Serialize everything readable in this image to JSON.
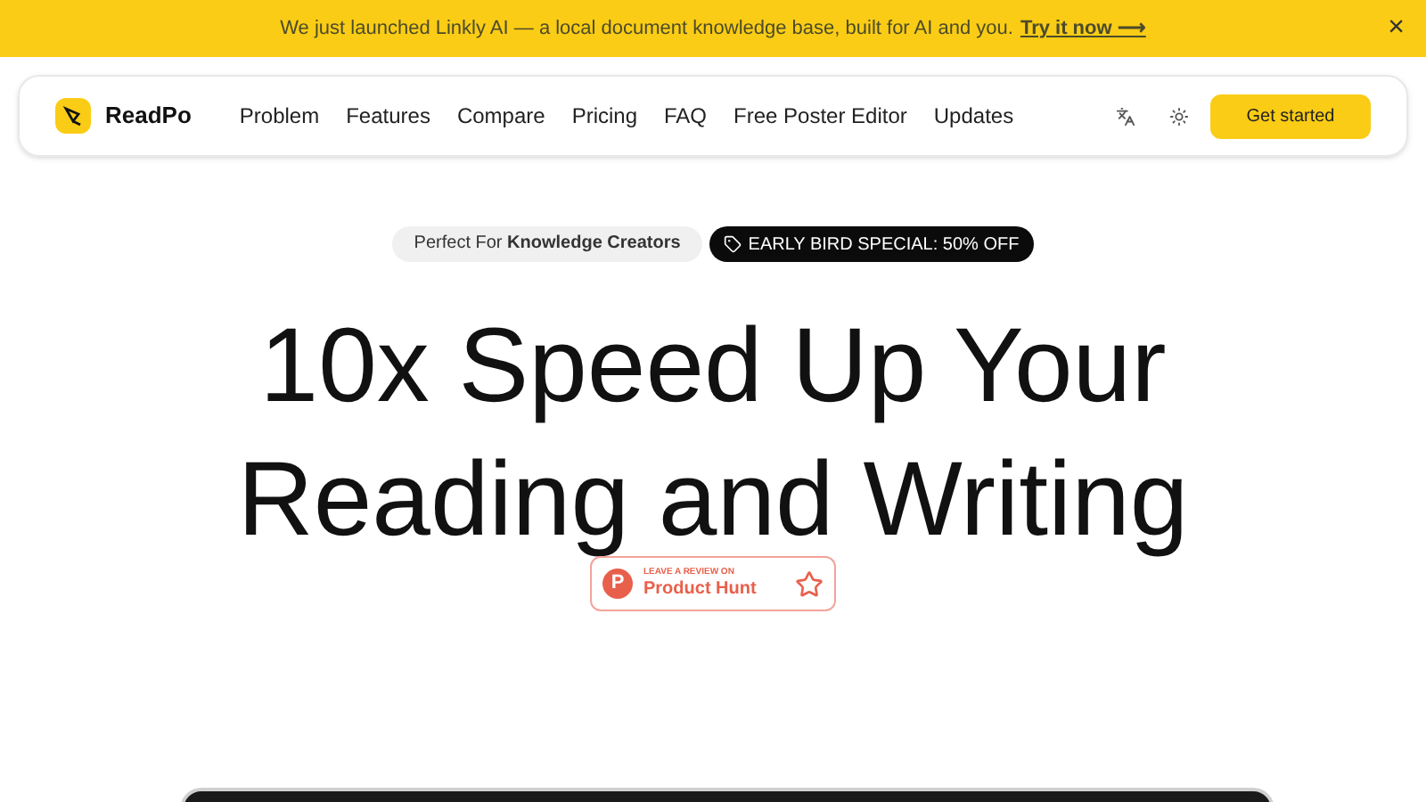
{
  "banner": {
    "text": "We just launched Linkly AI — a local document knowledge base, built for AI and you.",
    "link": "Try it now ⟶",
    "close": "×"
  },
  "nav": {
    "brand": "ReadPo",
    "items": [
      "Problem",
      "Features",
      "Compare",
      "Pricing",
      "FAQ",
      "Free Poster Editor",
      "Updates"
    ],
    "cta": "Get started"
  },
  "hero": {
    "badge": "Perfect For **Knowledge Creators**",
    "promo": "EARLY BIRD SPECIAL: 50% OFF",
    "title_lines": [
      "10x Speed Up Your",
      "Reading and Writing"
    ],
    "review": {
      "logo_letter": "P",
      "caption": "LEAVE A REVIEW ON",
      "name": "Product Hunt"
    }
  }
}
